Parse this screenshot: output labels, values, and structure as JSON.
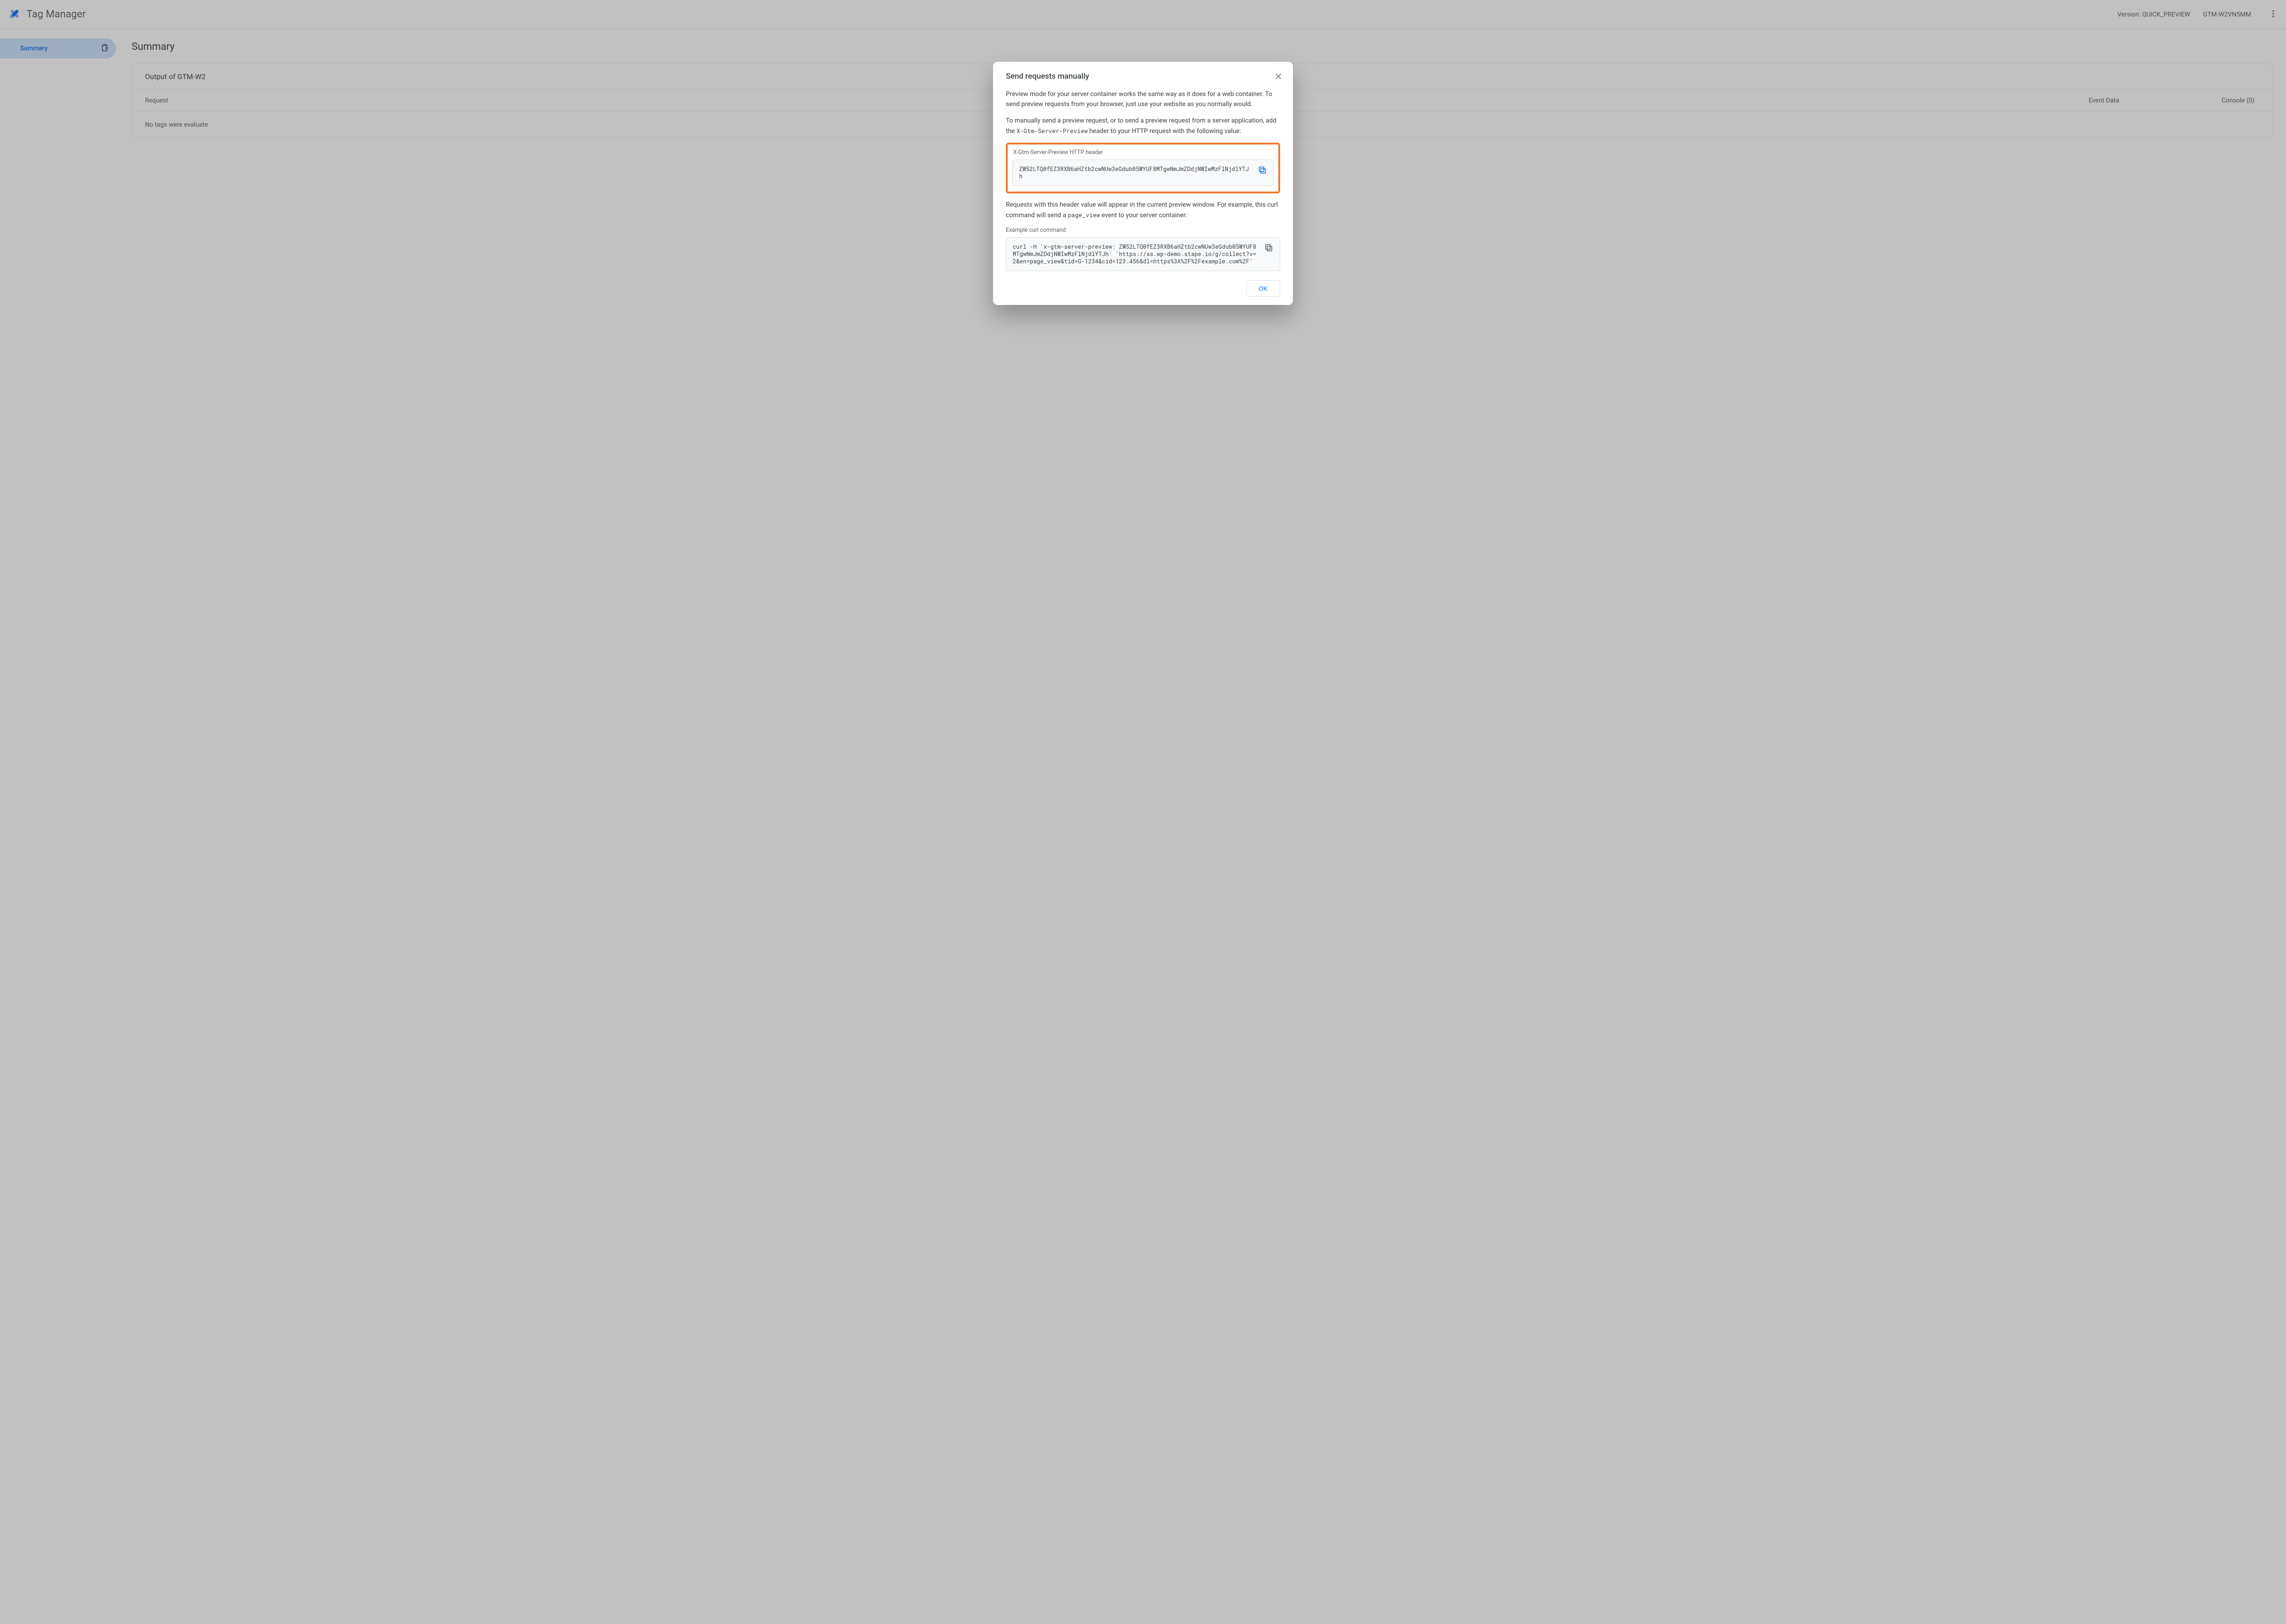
{
  "header": {
    "product": "Tag Manager",
    "version_label": "Version: QUICK_PREVIEW",
    "container_id": "GTM-W2VN5MM"
  },
  "sidebar": {
    "items": [
      {
        "label": "Summary"
      }
    ]
  },
  "main": {
    "title": "Summary",
    "panel_header": "Output of GTM-W2",
    "tabs": {
      "request": "Request",
      "event_data": "Event Data",
      "console": "Console (0)"
    },
    "body_text": "No tags were evaluate"
  },
  "dialog": {
    "title": "Send requests manually",
    "p1": "Preview mode for your server container works the same way as it does for a web container. To send preview requests from your browser, just use your website as you normally would.",
    "p2a": "To manually send a preview request, or to send a preview request from a server application, add the ",
    "p2code": "X-Gtm-Server-Preview",
    "p2b": " header to your HTTP request with the following value:",
    "header_label": "X-Gtm-Server-Preview HTTP header",
    "header_value": "ZW52LTQ0fEZ3RXB6aHZtb2cwNUw3eGdub05WYUF8MTgwNmJmZDdjNWIwMzFlNjdlYTJh",
    "p3a": "Requests with this header value will appear in the current preview window. For example, this curl command will send a ",
    "p3code": "page_view",
    "p3b": " event to your server container:",
    "curl_label": "Example curl command",
    "curl_value": "curl -H 'x-gtm-server-preview: ZW52LTQ0fEZ3RXB6aHZtb2cwNUw3eGdub05WYUF8MTgwNmJmZDdjNWIwMzFlNjdlYTJh' 'https://ss.wp-demo.stape.io/g/collect?v=2&en=page_view&tid=G-1234&cid=123.456&dl=https%3A%2F%2Fexample.com%2F'",
    "ok_label": "OK"
  }
}
